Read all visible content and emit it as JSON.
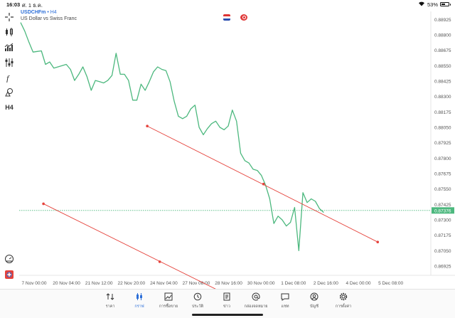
{
  "status_bar": {
    "time": "16:03",
    "date": "ศ. 1 ธ.ค.",
    "battery": "53%"
  },
  "symbol": {
    "name": "USDCHFm",
    "separator": " • ",
    "timeframe": "H4",
    "description": "US Dollar vs Swiss Franc"
  },
  "toolbar": {
    "timeframe_label": "H4"
  },
  "chart_data": {
    "type": "line",
    "series": [
      {
        "values": [
          0.889,
          0.8883,
          0.8874,
          0.8866,
          0.88665,
          0.8867,
          0.8856,
          0.8858,
          0.8853,
          0.8854,
          0.8855,
          0.8856,
          0.8852,
          0.8843,
          0.8848,
          0.8854,
          0.8846,
          0.8835,
          0.8843,
          0.8842,
          0.8841,
          0.8843,
          0.8847,
          0.8865,
          0.8848,
          0.8848,
          0.8843,
          0.8827,
          0.8827,
          0.884,
          0.8835,
          0.8842,
          0.885,
          0.8854,
          0.8852,
          0.8851,
          0.8842,
          0.8826,
          0.8814,
          0.8812,
          0.8814,
          0.882,
          0.8823,
          0.8805,
          0.8799,
          0.8804,
          0.8808,
          0.881,
          0.8805,
          0.8803,
          0.8806,
          0.8819,
          0.881,
          0.8784,
          0.8778,
          0.8776,
          0.8771,
          0.877,
          0.8766,
          0.8758,
          0.8747,
          0.8727,
          0.8733,
          0.873,
          0.8725,
          0.8728,
          0.874,
          0.8705,
          0.8752,
          0.8744,
          0.8747,
          0.8745,
          0.8739,
          0.8736
        ]
      }
    ],
    "x_tick_labels": [
      "7 Nov 00:00",
      "20 Nov 04:00",
      "21 Nov 12:00",
      "22 Nov 20:00",
      "24 Nov 04:00",
      "27 Nov 08:00",
      "28 Nov 16:00",
      "30 Nov 00:00",
      "1 Dec 08:00",
      "2 Dec 16:00",
      "4 Dec 00:00",
      "5 Dec 08:00"
    ],
    "y_tick_labels": [
      "0.88925",
      "0.88800",
      "0.88675",
      "0.88550",
      "0.88425",
      "0.88300",
      "0.88175",
      "0.88050",
      "0.87925",
      "0.87800",
      "0.87675",
      "0.87550",
      "0.87425",
      "0.87300",
      "0.87175",
      "0.87050",
      "0.86925"
    ],
    "ylim": [
      0.8685,
      0.8899
    ],
    "current_price": "0.87376",
    "trendlines": [
      {
        "start": {
          "bar": 30.5,
          "price": 0.8806
        },
        "mid": {
          "bar": 58.5,
          "price": 0.8759
        },
        "end": {
          "bar": 86,
          "price": 0.8712
        }
      },
      {
        "start": {
          "bar": 5.5,
          "price": 0.8743
        },
        "mid": {
          "bar": 33.5,
          "price": 0.8696
        },
        "end": {
          "bar": 47.5,
          "price": 0.8673
        }
      }
    ],
    "grid": false,
    "colors": {
      "line": "#4cb87e",
      "trendline": "#e5423b",
      "price_line": "#4cb87e",
      "price_badge": "#4cb87e"
    }
  },
  "bottom_nav": {
    "items": [
      {
        "label": "ราคา",
        "icon": "arrows-updown-icon"
      },
      {
        "label": "กราฟ",
        "icon": "candlestick-icon",
        "active": true
      },
      {
        "label": "การซื้อขาย",
        "icon": "trade-chart-icon"
      },
      {
        "label": "ประวัติ",
        "icon": "history-icon"
      },
      {
        "label": "ข่าว",
        "icon": "news-icon"
      },
      {
        "label": "กล่องจดหมาย",
        "icon": "at-mail-icon"
      },
      {
        "label": "แชท",
        "icon": "chat-icon"
      },
      {
        "label": "บัญชี",
        "icon": "account-icon"
      },
      {
        "label": "การตั้งค่า",
        "icon": "gear-icon"
      }
    ]
  },
  "colors": {
    "accent": "#2d6fd8"
  }
}
